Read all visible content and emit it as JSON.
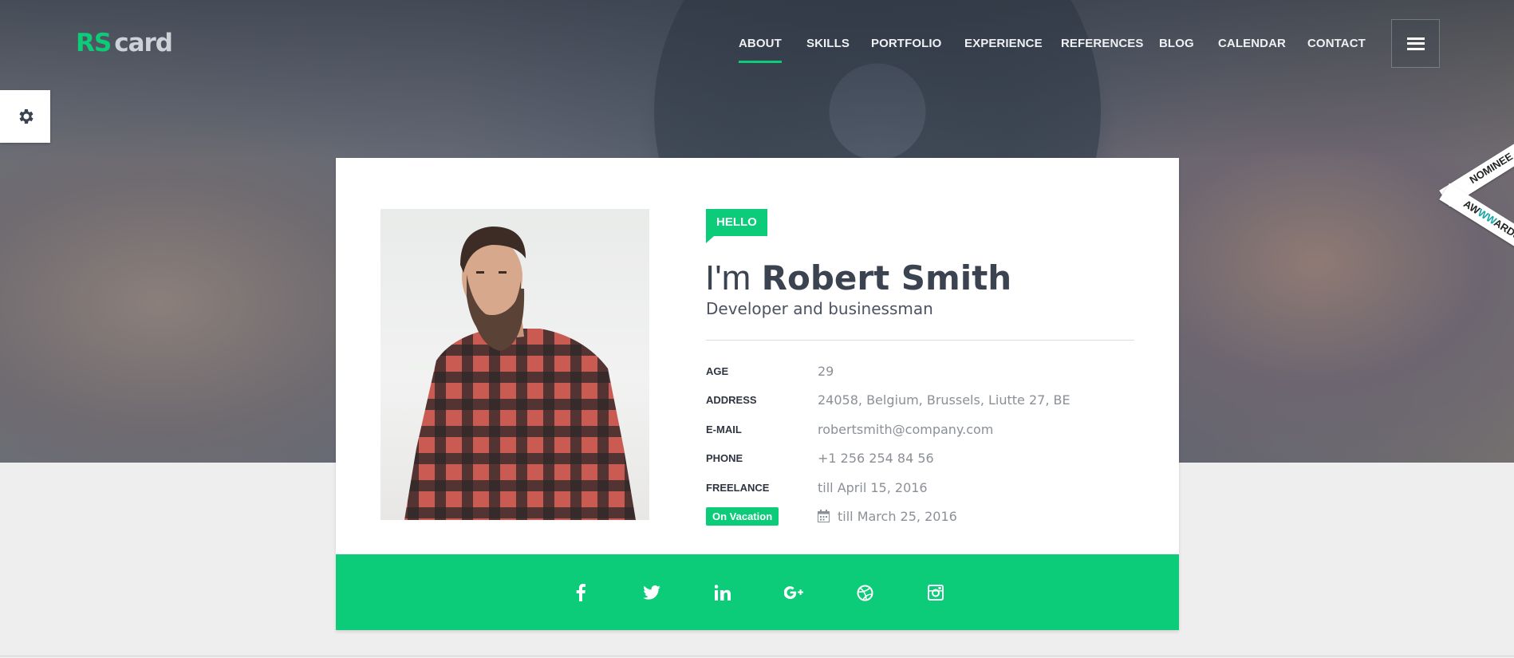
{
  "brand": {
    "logo_rs": "RS",
    "logo_card": "card"
  },
  "nav": {
    "items": [
      {
        "label": "ABOUT",
        "active": true
      },
      {
        "label": "SKILLS"
      },
      {
        "label": "PORTFOLIO"
      },
      {
        "label": "EXPERIENCE"
      },
      {
        "label": "REFERENCES"
      },
      {
        "label": "BLOG"
      },
      {
        "label": "CALENDAR"
      },
      {
        "label": "CONTACT"
      }
    ]
  },
  "ribbon": {
    "top": "NOMINEE",
    "bottom_pre": "AW",
    "bottom_mid": "WW",
    "bottom_post": "ARDS"
  },
  "profile": {
    "greeting": "HELLO",
    "name_prefix": "I'm",
    "name": "Robert Smith",
    "subtitle": "Developer and businessman",
    "info": [
      {
        "label": "AGE",
        "value": "29"
      },
      {
        "label": "ADDRESS",
        "value": "24058, Belgium, Brussels, Liutte 27, BE"
      },
      {
        "label": "E-MAIL",
        "value": "robertsmith@company.com"
      },
      {
        "label": "PHONE",
        "value": "+1 256 254 84 56"
      },
      {
        "label": "FREELANCE",
        "value": "till April 15, 2016"
      }
    ],
    "vacation": {
      "badge": "On Vacation",
      "value": "till March 25, 2016",
      "icon": "calendar-icon"
    }
  },
  "social": [
    "facebook-icon",
    "twitter-icon",
    "linkedin-icon",
    "google-plus-icon",
    "dribbble-icon",
    "instagram-icon"
  ],
  "colors": {
    "accent": "#0ccc79",
    "text_dark": "#3b4351",
    "text_muted": "#8b9097"
  }
}
